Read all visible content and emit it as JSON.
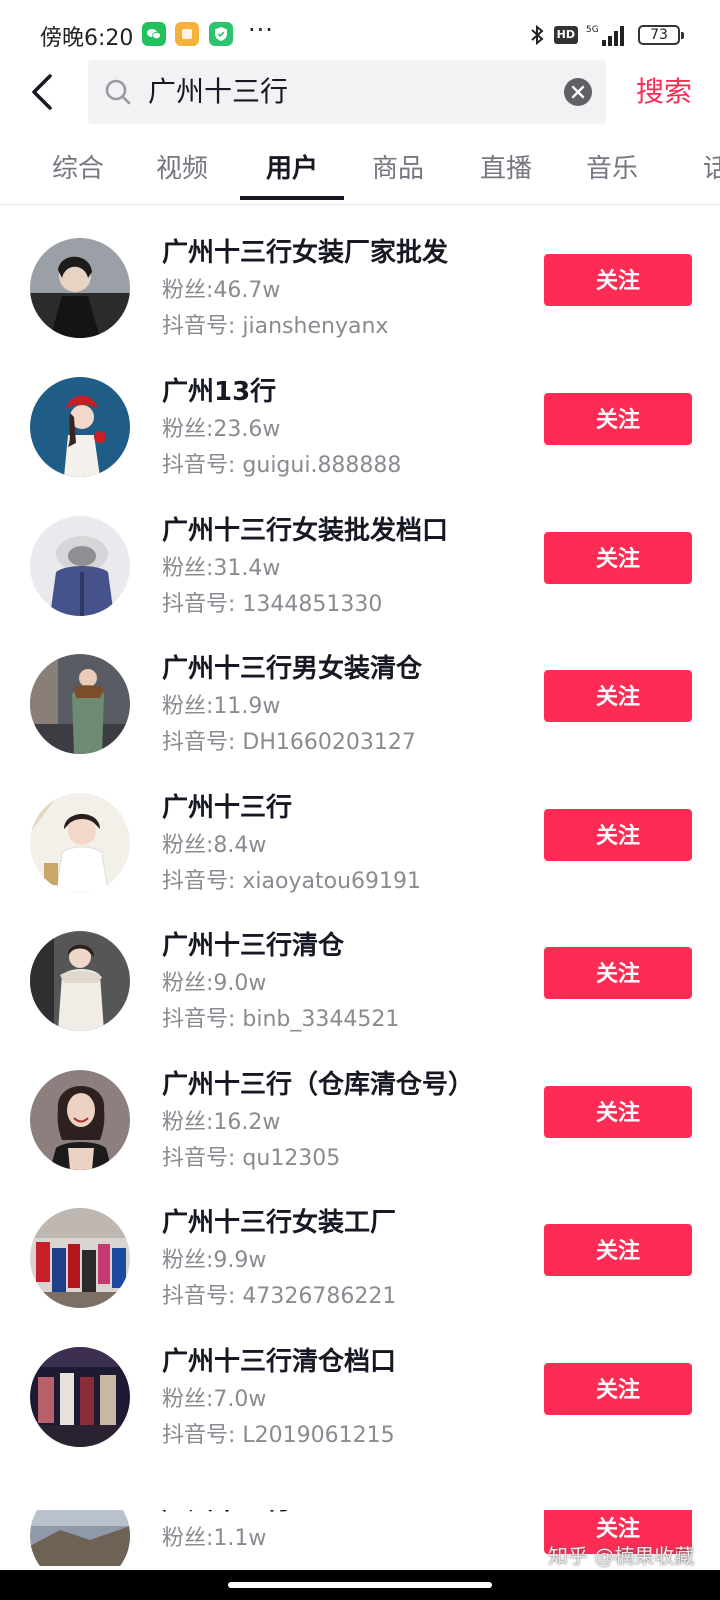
{
  "status_bar": {
    "time": "傍晚6:20",
    "more": "···",
    "hd": "HD",
    "network": "5G",
    "battery": "73"
  },
  "search": {
    "query": "广州十三行",
    "button_label": "搜索"
  },
  "tabs": [
    {
      "label": "综合",
      "active": false
    },
    {
      "label": "视频",
      "active": false
    },
    {
      "label": "用户",
      "active": true
    },
    {
      "label": "商品",
      "active": false
    },
    {
      "label": "直播",
      "active": false
    },
    {
      "label": "音乐",
      "active": false
    },
    {
      "label": "话",
      "active": false
    }
  ],
  "follow_label": "关注",
  "users": [
    {
      "name": "广州十三行女装厂家批发",
      "fans": "粉丝:46.7w",
      "douyin_id": "抖音号: jianshenyanx"
    },
    {
      "name": "广州13行",
      "fans": "粉丝:23.6w",
      "douyin_id": "抖音号: guigui.888888"
    },
    {
      "name": "广州十三行女装批发档口",
      "fans": "粉丝:31.4w",
      "douyin_id": "抖音号: 1344851330"
    },
    {
      "name": "广州十三行男女装清仓",
      "fans": "粉丝:11.9w",
      "douyin_id": "抖音号: DH1660203127"
    },
    {
      "name": "广州十三行",
      "fans": "粉丝:8.4w",
      "douyin_id": "抖音号: xiaoyatou69191"
    },
    {
      "name": "广州十三行清仓",
      "fans": "粉丝:9.0w",
      "douyin_id": "抖音号: binb_3344521"
    },
    {
      "name": "广州十三行（仓库清仓号）",
      "fans": "粉丝:16.2w",
      "douyin_id": "抖音号: qu12305"
    },
    {
      "name": "广州十三行女装工厂",
      "fans": "粉丝:9.9w",
      "douyin_id": "抖音号: 47326786221"
    },
    {
      "name": "广州十三行清仓档口",
      "fans": "粉丝:7.0w",
      "douyin_id": "抖音号: L2019061215"
    },
    {
      "name": "广州十三行",
      "fans": "粉丝:1.1w",
      "douyin_id": ""
    }
  ],
  "watermark": "知乎 @楠果收藏",
  "colors": {
    "accent": "#fe2c55",
    "text_primary": "#161823",
    "text_secondary": "#8a8b91"
  }
}
